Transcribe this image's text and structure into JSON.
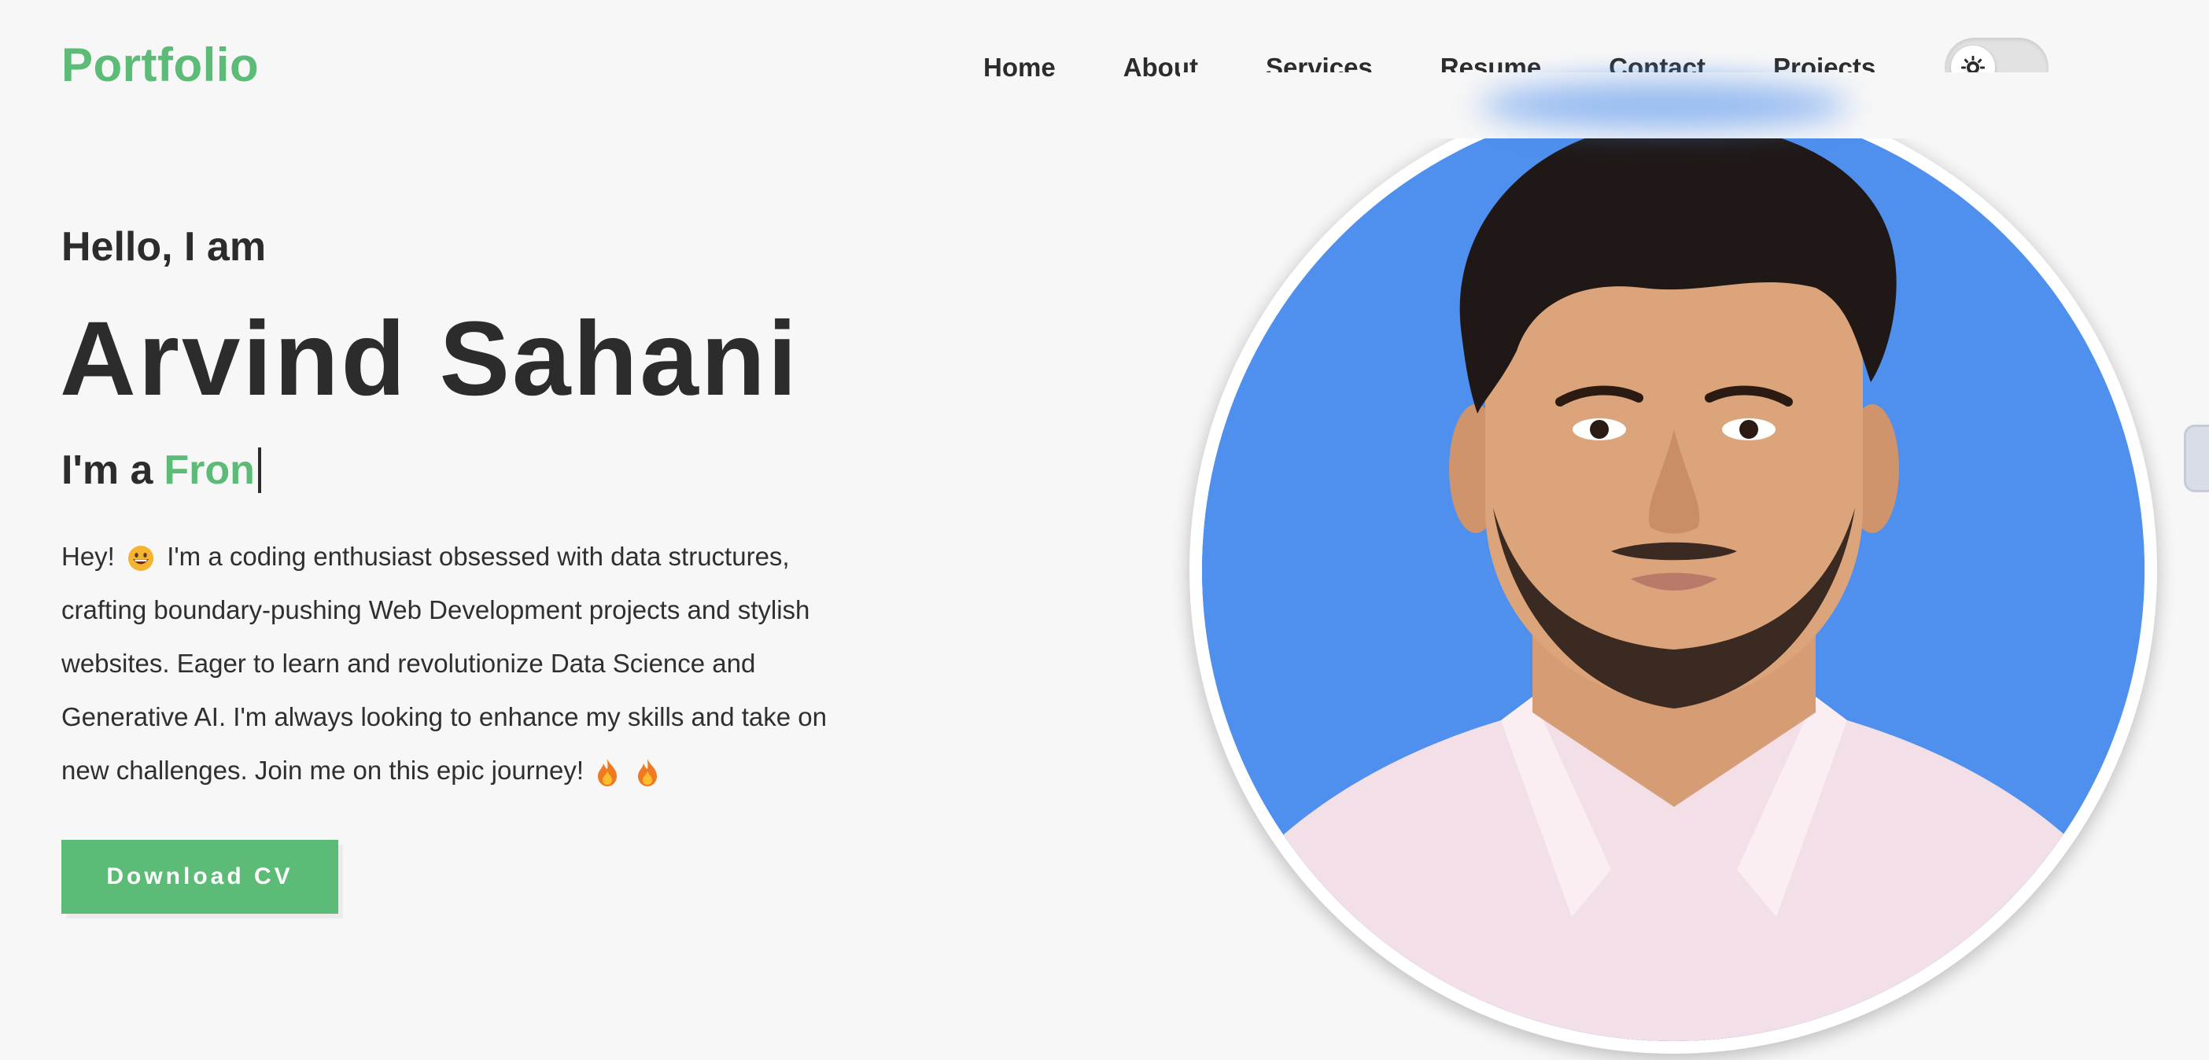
{
  "header": {
    "logo": "Portfolio",
    "nav": [
      "Home",
      "About",
      "Services",
      "Resume",
      "Contact",
      "Projects"
    ],
    "theme_toggle_icon": "sun-icon"
  },
  "hero": {
    "greeting": "Hello, I am",
    "name": "Arvind Sahani",
    "role_prefix": "I'm a",
    "role_typed": "Fron",
    "bio": {
      "part1": "Hey!",
      "part2": "I'm a coding enthusiast obsessed with data structures, crafting boundary-pushing Web Development projects and stylish websites. Eager to learn and revolutionize Data Science and Generative AI. I'm always looking to enhance my skills and take on new challenges. Join me on this epic journey!"
    },
    "download_label": "Download CV",
    "photo_alt": "profile-photo"
  },
  "colors": {
    "accent": "#5cbb76",
    "photo_background": "#4f8fed",
    "text": "#2c2c2c",
    "page_background": "#f7f7f7"
  }
}
